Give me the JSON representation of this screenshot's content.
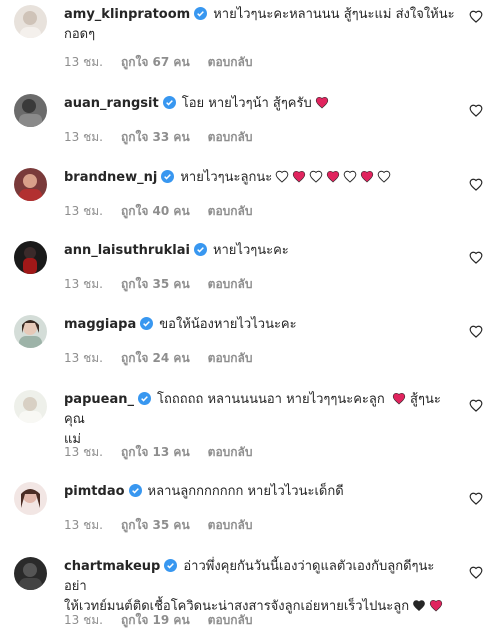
{
  "comments": [
    {
      "username": "amy_klinpratoom",
      "text_line1": "หายไวๆนะคะหลานนน สู้ๆนะแม่ ส่งใจให้นะ",
      "text_line2": "กอดๆ",
      "time": "13 ชม.",
      "likes": "ถูกใจ 67 คน",
      "reply": "ตอบกลับ",
      "emojis": []
    },
    {
      "username": "auan_rangsit",
      "text_line1": "โอย หายไวๆน้า สู้ๆครับ",
      "text_line2": "",
      "time": "13 ชม.",
      "likes": "ถูกใจ 33 คน",
      "reply": "ตอบกลับ",
      "emojis": [
        "red-heart"
      ]
    },
    {
      "username": "brandnew_nj",
      "text_line1": "หายไวๆนะลูกนะ",
      "text_line2": "",
      "time": "13 ชม.",
      "likes": "ถูกใจ 40 คน",
      "reply": "ตอบกลับ",
      "emojis": [
        "white-heart",
        "red-heart",
        "white-heart",
        "red-heart",
        "white-heart",
        "red-heart",
        "white-heart"
      ]
    },
    {
      "username": "ann_laisuthruklai",
      "text_line1": "หายไวๆนะคะ",
      "text_line2": "",
      "time": "13 ชม.",
      "likes": "ถูกใจ 35 คน",
      "reply": "ตอบกลับ",
      "emojis": []
    },
    {
      "username": "maggiapa",
      "text_line1": "ขอให้น้องหายไวไวนะคะ",
      "text_line2": "",
      "time": "13 ชม.",
      "likes": "ถูกใจ 24 คน",
      "reply": "ตอบกลับ",
      "emojis": []
    },
    {
      "username": "papuean_",
      "text_line1": "โถถถถถ หลานนนนอา หายไวๆๆนะคะลูก",
      "text_line1_tail": "สู้ๆนะคุณ",
      "text_line2": "แม่",
      "time": "13 ชม.",
      "likes": "ถูกใจ 13 คน",
      "reply": "ตอบกลับ",
      "emojis": [
        "red-heart"
      ]
    },
    {
      "username": "pimtdao",
      "text_line1": "หลานลูกกกกกกก หายไวไวนะเด็กดี",
      "text_line2": "",
      "time": "13 ชม.",
      "likes": "ถูกใจ 35 คน",
      "reply": "ตอบกลับ",
      "emojis": []
    },
    {
      "username": "chartmakeup",
      "text_line1": "อ่าวพึ่งคุยกันวันนี้เองว่าดูแลตัวเองกับลูกดีๆนะอย่า",
      "text_line2": "ให้เวทย์มนต์ติดเชื้อโควิดนะน่าสงสารจังลูกเอ่ยหายเร็วไปนะลูก",
      "time": "13 ชม.",
      "likes": "ถูกใจ 19 คน",
      "reply": "ตอบกลับ",
      "emojis": [
        "black-heart",
        "red-heart"
      ]
    }
  ],
  "colors": {
    "verified": "#3897f0",
    "meta": "#8e8e8e",
    "text": "#262626",
    "red_heart": "#e0245e"
  },
  "icons": {
    "like": "heart-outline-icon",
    "verified": "verified-badge-icon"
  }
}
